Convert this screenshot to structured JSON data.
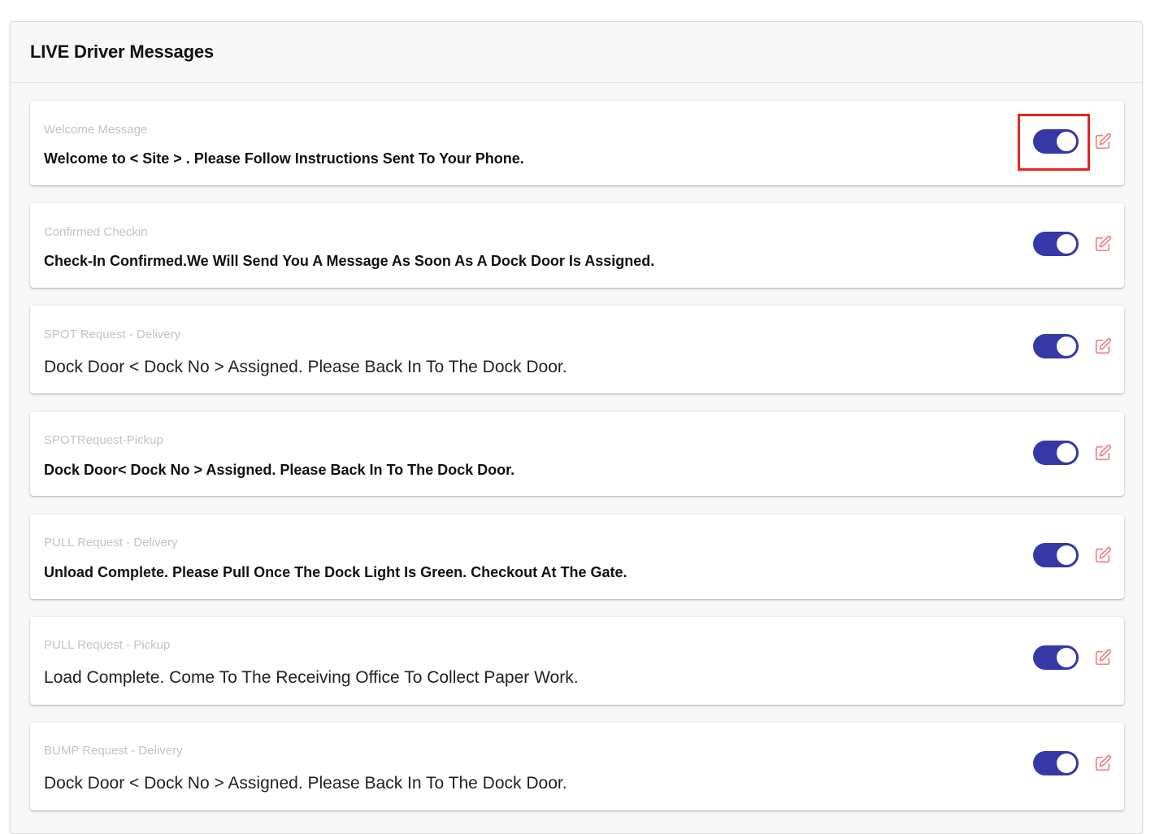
{
  "panel": {
    "title": "LIVE Driver Messages"
  },
  "messages": [
    {
      "label": "Welcome Message",
      "text": "Welcome to < Site > . Please Follow Instructions Sent To Your Phone.",
      "enabled": true
    },
    {
      "label": "Confirmed Checkin",
      "text": "Check-In Confirmed.We Will Send You A Message As Soon As A Dock Door Is Assigned.",
      "enabled": true
    },
    {
      "label": "SPOT Request - Delivery",
      "text": "Dock Door < Dock No > Assigned. Please Back In To The Dock Door.",
      "enabled": true
    },
    {
      "label": "SPOTRequest-Pickup",
      "text": "Dock Door< Dock No > Assigned. Please Back In To The Dock Door.",
      "enabled": true
    },
    {
      "label": "PULL Request - Delivery",
      "text": "Unload Complete. Please Pull Once The Dock Light Is Green. Checkout At The Gate.",
      "enabled": true
    },
    {
      "label": "PULL Request - Pickup",
      "text": "Load Complete. Come To The Receiving Office To Collect Paper Work.",
      "enabled": true
    },
    {
      "label": "BUMP Request - Delivery",
      "text": "Dock Door < Dock No > Assigned. Please Back In To The Dock Door.",
      "enabled": true
    }
  ],
  "colors": {
    "toggle_on": "#3538a6",
    "edit_icon": "#f08a8a",
    "highlight": "#e8251b"
  },
  "icons": {
    "edit": "edit-pencil-icon"
  }
}
